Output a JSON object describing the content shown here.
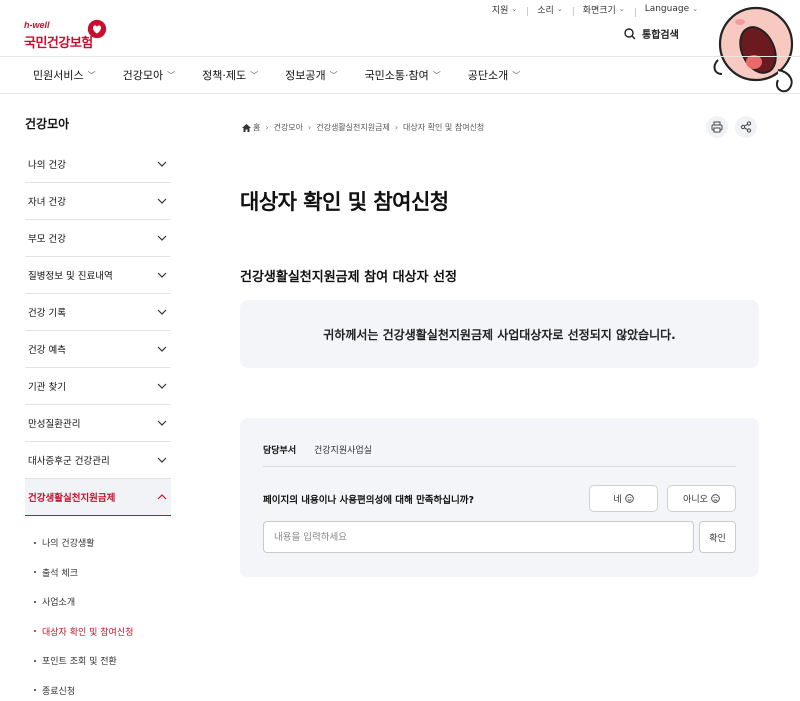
{
  "utility": {
    "items": [
      {
        "label": "지원",
        "has_chevron": true
      },
      {
        "label": "소리",
        "has_chevron": true
      },
      {
        "label": "화면크기",
        "has_chevron": true
      },
      {
        "label": "Language",
        "has_chevron": true
      }
    ]
  },
  "logo": {
    "sub": "h-well",
    "main": "국민건강보험"
  },
  "search": {
    "label": "통합검색"
  },
  "gnb": {
    "items": [
      {
        "label": "민원서비스"
      },
      {
        "label": "건강모아"
      },
      {
        "label": "정책·제도"
      },
      {
        "label": "정보공개"
      },
      {
        "label": "국민소통·참여"
      },
      {
        "label": "공단소개"
      }
    ]
  },
  "sidebar": {
    "title": "건강모아",
    "items": [
      {
        "label": "나의 건강"
      },
      {
        "label": "자녀 건강"
      },
      {
        "label": "부모 건강"
      },
      {
        "label": "질병정보 및 진료내역"
      },
      {
        "label": "건강 기록"
      },
      {
        "label": "건강 예측"
      },
      {
        "label": "기관 찾기"
      },
      {
        "label": "만성질환관리"
      },
      {
        "label": "대사증후군 건강관리"
      },
      {
        "label": "건강생활실천지원금제"
      }
    ],
    "sub_items": [
      {
        "label": "나의 건강생활"
      },
      {
        "label": "출석 체크"
      },
      {
        "label": "사업소개"
      },
      {
        "label": "대상자 확인 및 참여신청"
      },
      {
        "label": "포인트 조회 및 전환"
      },
      {
        "label": "종료신청"
      }
    ]
  },
  "breadcrumb": {
    "items": [
      "홈",
      "건강모아",
      "건강생활실천지원금제",
      "대상자 확인 및 참여신청"
    ]
  },
  "main": {
    "title": "대상자 확인 및 참여신청",
    "section_title": "건강생활실천지원금제 참여 대상자 선정",
    "notice": "귀하께서는 건강생활실천지원금제 사업대상자로 선정되지 않았습니다."
  },
  "feedback": {
    "dept_label": "담당부서",
    "dept_value": "건강지원사업실",
    "question": "페이지의 내용이나 사용편의성에 대해 만족하십니까?",
    "yes_label": "네",
    "no_label": "아니오",
    "input_placeholder": "내용을 입력하세요",
    "submit_label": "확인"
  },
  "colors": {
    "brand": "#c8102e",
    "panel": "#f4f5f9"
  }
}
